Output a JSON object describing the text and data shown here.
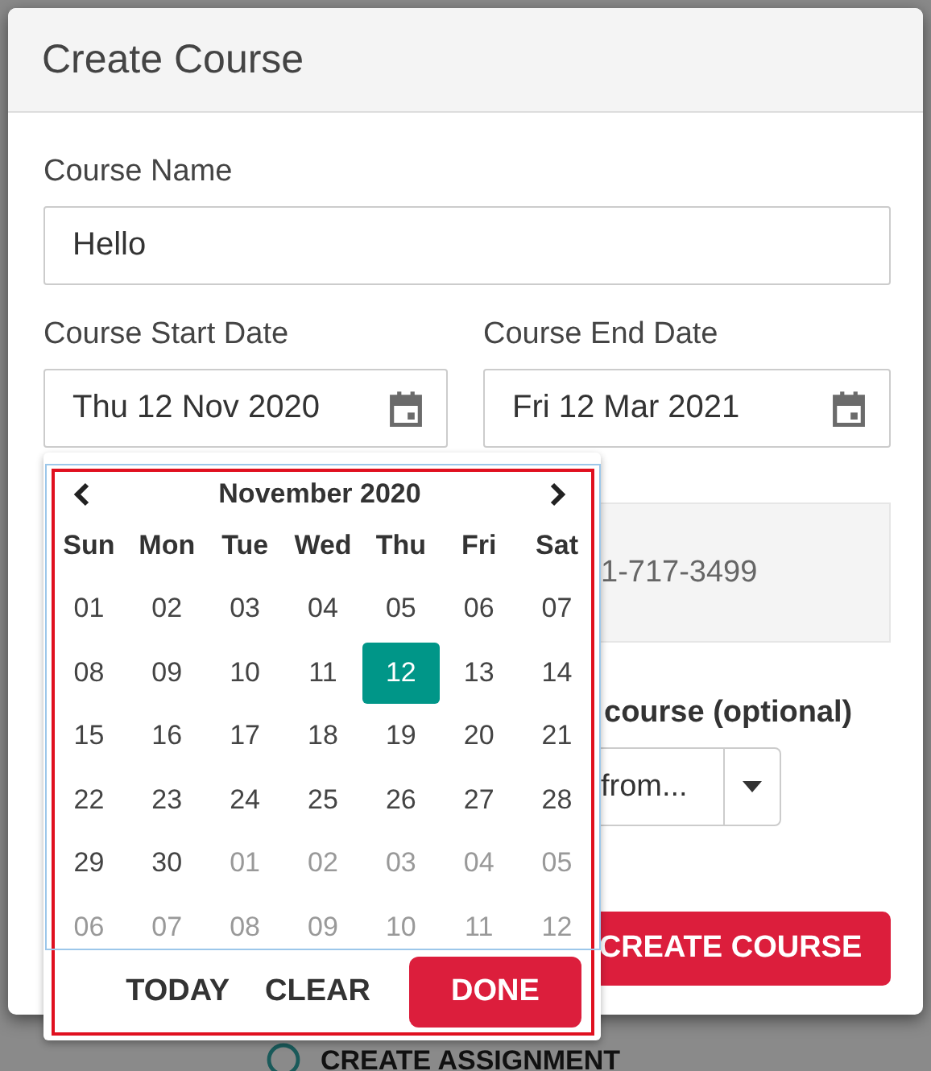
{
  "dialog": {
    "title": "Create Course"
  },
  "course_name": {
    "label": "Course Name",
    "value": "Hello"
  },
  "start_date": {
    "label": "Course Start Date",
    "value": "Thu 12 Nov 2020"
  },
  "end_date": {
    "label": "Course End Date",
    "value": "Fri 12 Mar 2021"
  },
  "phone_field": {
    "value": "1-717-3499"
  },
  "copy_from": {
    "label": "course (optional)",
    "value": "from..."
  },
  "create_button": "CREATE COURSE",
  "background": {
    "action": "CREATE ASSIGNMENT"
  },
  "date_picker": {
    "month": "November 2020",
    "weekdays": [
      "Sun",
      "Mon",
      "Tue",
      "Wed",
      "Thu",
      "Fri",
      "Sat"
    ],
    "days": [
      {
        "label": "01",
        "other_month": false,
        "selected": false
      },
      {
        "label": "02",
        "other_month": false,
        "selected": false
      },
      {
        "label": "03",
        "other_month": false,
        "selected": false
      },
      {
        "label": "04",
        "other_month": false,
        "selected": false
      },
      {
        "label": "05",
        "other_month": false,
        "selected": false
      },
      {
        "label": "06",
        "other_month": false,
        "selected": false
      },
      {
        "label": "07",
        "other_month": false,
        "selected": false
      },
      {
        "label": "08",
        "other_month": false,
        "selected": false
      },
      {
        "label": "09",
        "other_month": false,
        "selected": false
      },
      {
        "label": "10",
        "other_month": false,
        "selected": false
      },
      {
        "label": "11",
        "other_month": false,
        "selected": false
      },
      {
        "label": "12",
        "other_month": false,
        "selected": true
      },
      {
        "label": "13",
        "other_month": false,
        "selected": false
      },
      {
        "label": "14",
        "other_month": false,
        "selected": false
      },
      {
        "label": "15",
        "other_month": false,
        "selected": false
      },
      {
        "label": "16",
        "other_month": false,
        "selected": false
      },
      {
        "label": "17",
        "other_month": false,
        "selected": false
      },
      {
        "label": "18",
        "other_month": false,
        "selected": false
      },
      {
        "label": "19",
        "other_month": false,
        "selected": false
      },
      {
        "label": "20",
        "other_month": false,
        "selected": false
      },
      {
        "label": "21",
        "other_month": false,
        "selected": false
      },
      {
        "label": "22",
        "other_month": false,
        "selected": false
      },
      {
        "label": "23",
        "other_month": false,
        "selected": false
      },
      {
        "label": "24",
        "other_month": false,
        "selected": false
      },
      {
        "label": "25",
        "other_month": false,
        "selected": false
      },
      {
        "label": "26",
        "other_month": false,
        "selected": false
      },
      {
        "label": "27",
        "other_month": false,
        "selected": false
      },
      {
        "label": "28",
        "other_month": false,
        "selected": false
      },
      {
        "label": "29",
        "other_month": false,
        "selected": false
      },
      {
        "label": "30",
        "other_month": false,
        "selected": false
      },
      {
        "label": "01",
        "other_month": true,
        "selected": false
      },
      {
        "label": "02",
        "other_month": true,
        "selected": false
      },
      {
        "label": "03",
        "other_month": true,
        "selected": false
      },
      {
        "label": "04",
        "other_month": true,
        "selected": false
      },
      {
        "label": "05",
        "other_month": true,
        "selected": false
      },
      {
        "label": "06",
        "other_month": true,
        "selected": false
      },
      {
        "label": "07",
        "other_month": true,
        "selected": false
      },
      {
        "label": "08",
        "other_month": true,
        "selected": false
      },
      {
        "label": "09",
        "other_month": true,
        "selected": false
      },
      {
        "label": "10",
        "other_month": true,
        "selected": false
      },
      {
        "label": "11",
        "other_month": true,
        "selected": false
      },
      {
        "label": "12",
        "other_month": true,
        "selected": false
      }
    ],
    "buttons": [
      {
        "label": "TODAY",
        "kind": "text"
      },
      {
        "label": "CLEAR",
        "kind": "text"
      },
      {
        "label": "DONE",
        "kind": "primary"
      }
    ]
  }
}
